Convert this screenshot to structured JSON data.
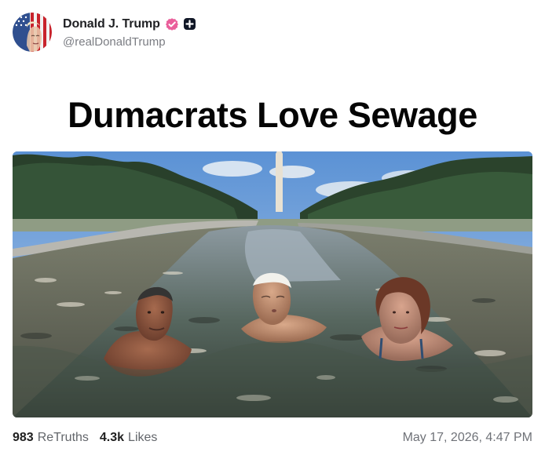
{
  "author": {
    "display_name": "Donald J. Trump",
    "handle": "@realDonaldTrump",
    "avatar_icon": "avatar-flag-portrait",
    "verified_icon": "verified-badge-icon",
    "plus_icon": "plus-badge-icon"
  },
  "post": {
    "headline": "Dumacrats Love Sewage",
    "image_icon": "post-image"
  },
  "stats": {
    "retruths_count": "983",
    "retruths_label": "ReTruths",
    "likes_count": "4.3k",
    "likes_label": "Likes"
  },
  "timestamp": "May 17, 2026, 4:47 PM",
  "colors": {
    "accent_verified": "#ea5f9b",
    "text_primary": "#1f1f1f",
    "text_secondary": "#7b7d83",
    "background": "#ffffff"
  }
}
